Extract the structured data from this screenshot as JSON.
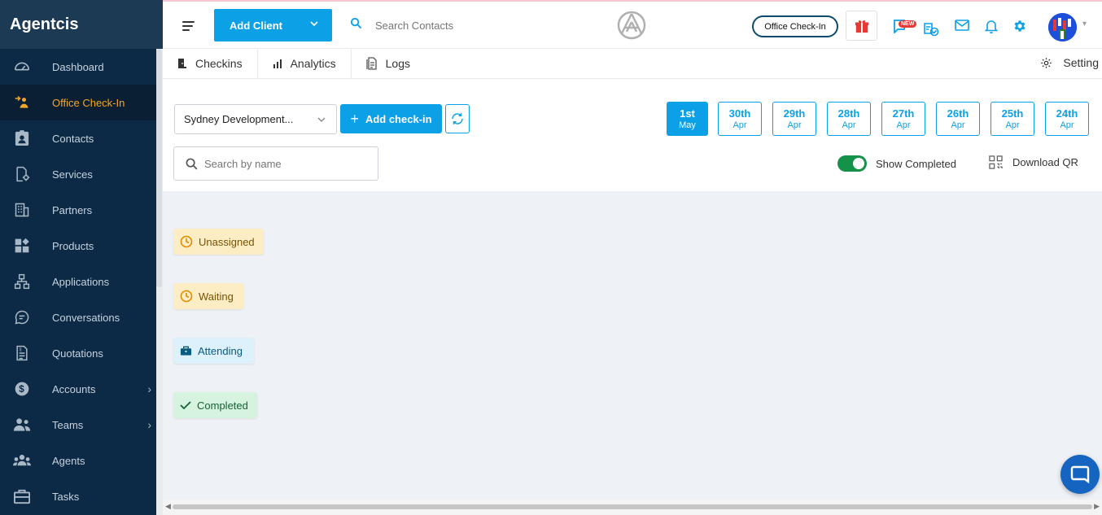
{
  "app": {
    "brand": "Agentcis"
  },
  "sidebar": {
    "items": [
      {
        "label": "Dashboard",
        "icon": "gauge-icon"
      },
      {
        "label": "Office Check-In",
        "icon": "checkin-icon",
        "active": true
      },
      {
        "label": "Contacts",
        "icon": "contact-card-icon"
      },
      {
        "label": "Services",
        "icon": "services-icon"
      },
      {
        "label": "Partners",
        "icon": "building-icon"
      },
      {
        "label": "Products",
        "icon": "products-icon"
      },
      {
        "label": "Applications",
        "icon": "applications-icon"
      },
      {
        "label": "Conversations",
        "icon": "chat-icon"
      },
      {
        "label": "Quotations",
        "icon": "quotation-icon"
      },
      {
        "label": "Accounts",
        "icon": "dollar-icon",
        "expandable": true
      },
      {
        "label": "Teams",
        "icon": "team-icon",
        "expandable": true
      },
      {
        "label": "Agents",
        "icon": "agents-icon"
      },
      {
        "label": "Tasks",
        "icon": "briefcase-icon"
      }
    ]
  },
  "topbar": {
    "add_client_label": "Add Client",
    "search_placeholder": "Search Contacts",
    "office_checkin_label": "Office Check-In",
    "new_badge": "NEW"
  },
  "subnav": {
    "tabs": [
      {
        "label": "Checkins",
        "icon": "door-icon"
      },
      {
        "label": "Analytics",
        "icon": "bar-chart-icon"
      },
      {
        "label": "Logs",
        "icon": "logs-icon"
      }
    ],
    "setting_label": "Setting"
  },
  "toolbar": {
    "branch_value": "Sydney Development...",
    "add_checkin_label": "Add check-in",
    "search_placeholder": "Search by name",
    "show_completed_label": "Show Completed",
    "show_completed": true,
    "download_qr_label": "Download QR",
    "dates": [
      {
        "day": "1st",
        "month": "May",
        "active": true
      },
      {
        "day": "30th",
        "month": "Apr"
      },
      {
        "day": "29th",
        "month": "Apr"
      },
      {
        "day": "28th",
        "month": "Apr"
      },
      {
        "day": "27th",
        "month": "Apr"
      },
      {
        "day": "26th",
        "month": "Apr"
      },
      {
        "day": "25th",
        "month": "Apr"
      },
      {
        "day": "24th",
        "month": "Apr"
      }
    ]
  },
  "statuses": {
    "unassigned": "Unassigned",
    "waiting": "Waiting",
    "attending": "Attending",
    "completed": "Completed"
  },
  "colors": {
    "primary": "#0ca1e6",
    "sidebar_bg": "#0c2a45",
    "active_accent": "#f6a623",
    "toggle_on": "#15924a"
  }
}
